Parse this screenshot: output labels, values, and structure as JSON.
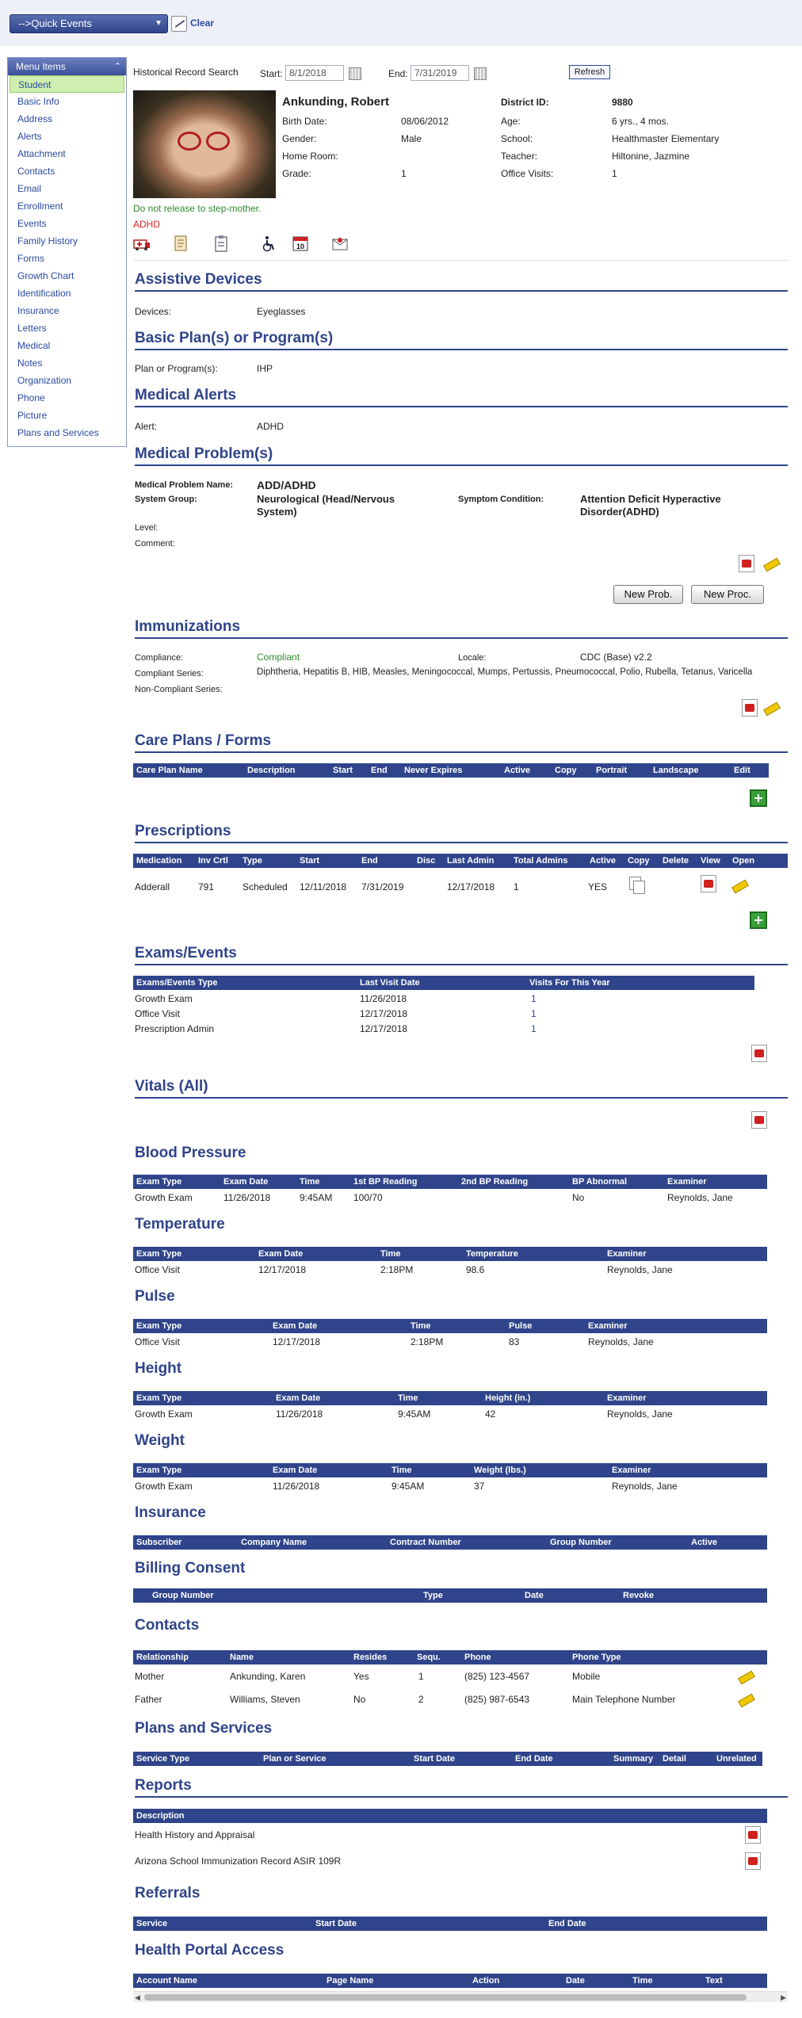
{
  "topbar": {
    "quick_events": "-->Quick Events",
    "clear": "Clear"
  },
  "menu": {
    "title": "Menu Items",
    "items": [
      "Student",
      "Basic Info",
      "Address",
      "Alerts",
      "Attachment",
      "Contacts",
      "Email",
      "Enrollment",
      "Events",
      "Family History",
      "Forms",
      "Growth Chart",
      "Identification",
      "Insurance",
      "Letters",
      "Medical",
      "Notes",
      "Organization",
      "Phone",
      "Picture",
      "Plans and Services"
    ]
  },
  "search": {
    "label": "Historical Record Search",
    "start_label": "Start:",
    "start_value": "8/1/2018",
    "end_label": "End:",
    "end_value": "7/31/2019",
    "refresh": "Refresh"
  },
  "student": {
    "name": "Ankunding, Robert",
    "birth_label": "Birth Date:",
    "birth": "08/06/2012",
    "gender_label": "Gender:",
    "gender": "Male",
    "homeroom_label": "Home Room:",
    "homeroom": "",
    "grade_label": "Grade:",
    "grade": "1",
    "district_label": "District ID:",
    "district": "9880",
    "age_label": "Age:",
    "age": "6 yrs., 4 mos.",
    "school_label": "School:",
    "school": "Healthmaster Elementary",
    "teacher_label": "Teacher:",
    "teacher": "Hiltonine, Jazmine",
    "visits_label": "Office Visits:",
    "visits": "1",
    "note": "Do not release to step-mother.",
    "alert": "ADHD"
  },
  "assistive": {
    "title": "Assistive Devices",
    "label": "Devices:",
    "value": "Eyeglasses"
  },
  "plans": {
    "title": "Basic Plan(s) or Program(s)",
    "label": "Plan or Program(s):",
    "value": "IHP"
  },
  "alerts": {
    "title": "Medical Alerts",
    "label": "Alert:",
    "value": "ADHD"
  },
  "problems": {
    "title": "Medical Problem(s)",
    "name_label": "Medical Problem Name:",
    "name": "ADD/ADHD",
    "group_label": "System Group:",
    "group": "Neurological (Head/Nervous System)",
    "symptom_label": "Symptom Condition:",
    "symptom": "Attention Deficit Hyperactive Disorder(ADHD)",
    "level_label": "Level:",
    "comment_label": "Comment:",
    "new_prob": "New Prob.",
    "new_proc": "New Proc."
  },
  "immun": {
    "title": "Immunizations",
    "compliance_label": "Compliance:",
    "compliance": "Compliant",
    "locale_label": "Locale:",
    "locale": "CDC (Base) v2.2",
    "series_label": "Compliant Series:",
    "series": "Diphtheria, Hepatitis B, HIB, Measles, Meningococcal, Mumps, Pertussis, Pneumococcal, Polio, Rubella, Tetanus, Varicella",
    "noncompliant_label": "Non-Compliant Series:"
  },
  "careplans": {
    "title": "Care Plans / Forms",
    "headers": [
      "Care Plan Name",
      "Description",
      "Start",
      "End",
      "Never Expires",
      "Active",
      "Copy",
      "Portrait",
      "Landscape",
      "Edit"
    ]
  },
  "rx": {
    "title": "Prescriptions",
    "headers": [
      "Medication",
      "Inv Crtl",
      "Type",
      "Start",
      "End",
      "Disc",
      "Last Admin",
      "Total Admins",
      "Active",
      "Copy",
      "Delete",
      "View",
      "Open"
    ],
    "row": [
      "Adderall",
      "791",
      "Scheduled",
      "12/11/2018",
      "7/31/2019",
      "",
      "12/17/2018",
      "1",
      "YES"
    ]
  },
  "exams": {
    "title": "Exams/Events",
    "headers": [
      "Exams/Events Type",
      "Last Visit Date",
      "Visits For This Year"
    ],
    "rows": [
      [
        "Growth Exam",
        "11/26/2018",
        "1"
      ],
      [
        "Office Visit",
        "12/17/2018",
        "1"
      ],
      [
        "Prescription Admin",
        "12/17/2018",
        "1"
      ]
    ]
  },
  "vitals": {
    "title": "Vitals (All)"
  },
  "bp": {
    "title": "Blood Pressure",
    "headers": [
      "Exam Type",
      "Exam Date",
      "Time",
      "1st BP Reading",
      "2nd BP Reading",
      "BP Abnormal",
      "Examiner"
    ],
    "row": [
      "Growth Exam",
      "11/26/2018",
      "9:45AM",
      "100/70",
      "",
      "No",
      "Reynolds, Jane"
    ]
  },
  "temp": {
    "title": "Temperature",
    "headers": [
      "Exam Type",
      "Exam Date",
      "Time",
      "Temperature",
      "Examiner"
    ],
    "row": [
      "Office Visit",
      "12/17/2018",
      "2:18PM",
      "98.6",
      "Reynolds, Jane"
    ]
  },
  "pulse": {
    "title": "Pulse",
    "headers": [
      "Exam Type",
      "Exam Date",
      "Time",
      "Pulse",
      "Examiner"
    ],
    "row": [
      "Office Visit",
      "12/17/2018",
      "2:18PM",
      "83",
      "Reynolds, Jane"
    ]
  },
  "height": {
    "title": "Height",
    "headers": [
      "Exam Type",
      "Exam Date",
      "Time",
      "Height (in.)",
      "Examiner"
    ],
    "row": [
      "Growth Exam",
      "11/26/2018",
      "9:45AM",
      "42",
      "Reynolds, Jane"
    ]
  },
  "weight": {
    "title": "Weight",
    "headers": [
      "Exam Type",
      "Exam Date",
      "Time",
      "Weight (lbs.)",
      "Examiner"
    ],
    "row": [
      "Growth Exam",
      "11/26/2018",
      "9:45AM",
      "37",
      "Reynolds, Jane"
    ]
  },
  "insurance": {
    "title": "Insurance",
    "headers": [
      "Subscriber",
      "Company Name",
      "Contract Number",
      "Group Number",
      "Active"
    ]
  },
  "billing": {
    "title": "Billing Consent",
    "headers": [
      "Group Number",
      "Type",
      "Date",
      "Revoke"
    ]
  },
  "contacts": {
    "title": "Contacts",
    "headers": [
      "Relationship",
      "Name",
      "Resides",
      "Sequ.",
      "Phone",
      "Phone Type"
    ],
    "rows": [
      [
        "Mother",
        "Ankunding, Karen",
        "Yes",
        "1",
        "(825) 123-4567",
        "Mobile"
      ],
      [
        "Father",
        "Williams, Steven",
        "No",
        "2",
        "(825) 987-6543",
        "Main Telephone Number"
      ]
    ]
  },
  "plansvc": {
    "title": "Plans and Services",
    "headers": [
      "Service Type",
      "Plan or Service",
      "Start Date",
      "End Date",
      "Summary",
      "Detail",
      "Unrelated"
    ]
  },
  "reports": {
    "title": "Reports",
    "headers": [
      "Description"
    ],
    "rows": [
      "Health History and Appraisal",
      "Arizona School Immunization Record ASIR 109R"
    ]
  },
  "referrals": {
    "title": "Referrals",
    "headers": [
      "Service",
      "Start Date",
      "End Date"
    ]
  },
  "portal": {
    "title": "Health Portal Access",
    "headers": [
      "Account Name",
      "Page Name",
      "Action",
      "Date",
      "Time",
      "Text"
    ]
  }
}
